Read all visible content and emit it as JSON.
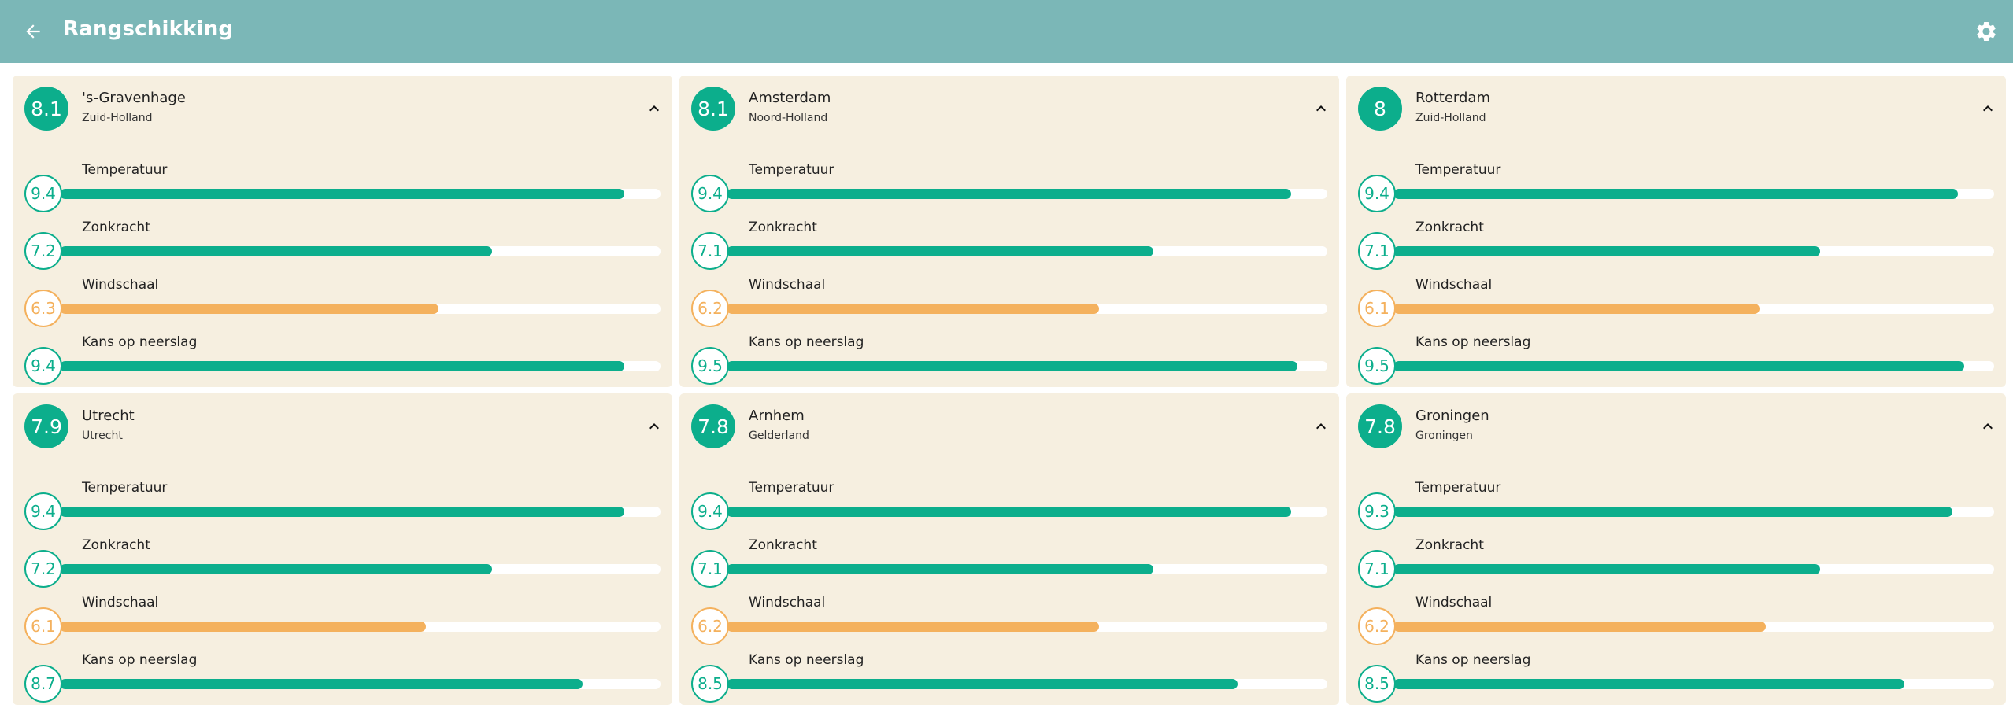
{
  "header": {
    "title": "Rangschikking",
    "back_icon": "arrow-left-icon",
    "settings_icon": "gear-icon",
    "background_color": "#7bb7b7"
  },
  "colors": {
    "good": "#0cae8c",
    "medium": "#f4b15d",
    "card_bg": "#f6efe0"
  },
  "cards": [
    {
      "score": "8.1",
      "city": "'s-Gravenhage",
      "province": "Zuid-Holland",
      "metrics": [
        {
          "label": "Temperatuur",
          "value": "9.4",
          "level": "green"
        },
        {
          "label": "Zonkracht",
          "value": "7.2",
          "level": "green"
        },
        {
          "label": "Windschaal",
          "value": "6.3",
          "level": "orange"
        },
        {
          "label": "Kans op neerslag",
          "value": "9.4",
          "level": "green"
        }
      ]
    },
    {
      "score": "8.1",
      "city": "Amsterdam",
      "province": "Noord-Holland",
      "metrics": [
        {
          "label": "Temperatuur",
          "value": "9.4",
          "level": "green"
        },
        {
          "label": "Zonkracht",
          "value": "7.1",
          "level": "green"
        },
        {
          "label": "Windschaal",
          "value": "6.2",
          "level": "orange"
        },
        {
          "label": "Kans op neerslag",
          "value": "9.5",
          "level": "green"
        }
      ]
    },
    {
      "score": "8",
      "city": "Rotterdam",
      "province": "Zuid-Holland",
      "metrics": [
        {
          "label": "Temperatuur",
          "value": "9.4",
          "level": "green"
        },
        {
          "label": "Zonkracht",
          "value": "7.1",
          "level": "green"
        },
        {
          "label": "Windschaal",
          "value": "6.1",
          "level": "orange"
        },
        {
          "label": "Kans op neerslag",
          "value": "9.5",
          "level": "green"
        }
      ]
    },
    {
      "score": "7.9",
      "city": "Utrecht",
      "province": "Utrecht",
      "metrics": [
        {
          "label": "Temperatuur",
          "value": "9.4",
          "level": "green"
        },
        {
          "label": "Zonkracht",
          "value": "7.2",
          "level": "green"
        },
        {
          "label": "Windschaal",
          "value": "6.1",
          "level": "orange"
        },
        {
          "label": "Kans op neerslag",
          "value": "8.7",
          "level": "green"
        }
      ]
    },
    {
      "score": "7.8",
      "city": "Arnhem",
      "province": "Gelderland",
      "metrics": [
        {
          "label": "Temperatuur",
          "value": "9.4",
          "level": "green"
        },
        {
          "label": "Zonkracht",
          "value": "7.1",
          "level": "green"
        },
        {
          "label": "Windschaal",
          "value": "6.2",
          "level": "orange"
        },
        {
          "label": "Kans op neerslag",
          "value": "8.5",
          "level": "green"
        }
      ]
    },
    {
      "score": "7.8",
      "city": "Groningen",
      "province": "Groningen",
      "metrics": [
        {
          "label": "Temperatuur",
          "value": "9.3",
          "level": "green"
        },
        {
          "label": "Zonkracht",
          "value": "7.1",
          "level": "green"
        },
        {
          "label": "Windschaal",
          "value": "6.2",
          "level": "orange"
        },
        {
          "label": "Kans op neerslag",
          "value": "8.5",
          "level": "green"
        }
      ]
    }
  ]
}
